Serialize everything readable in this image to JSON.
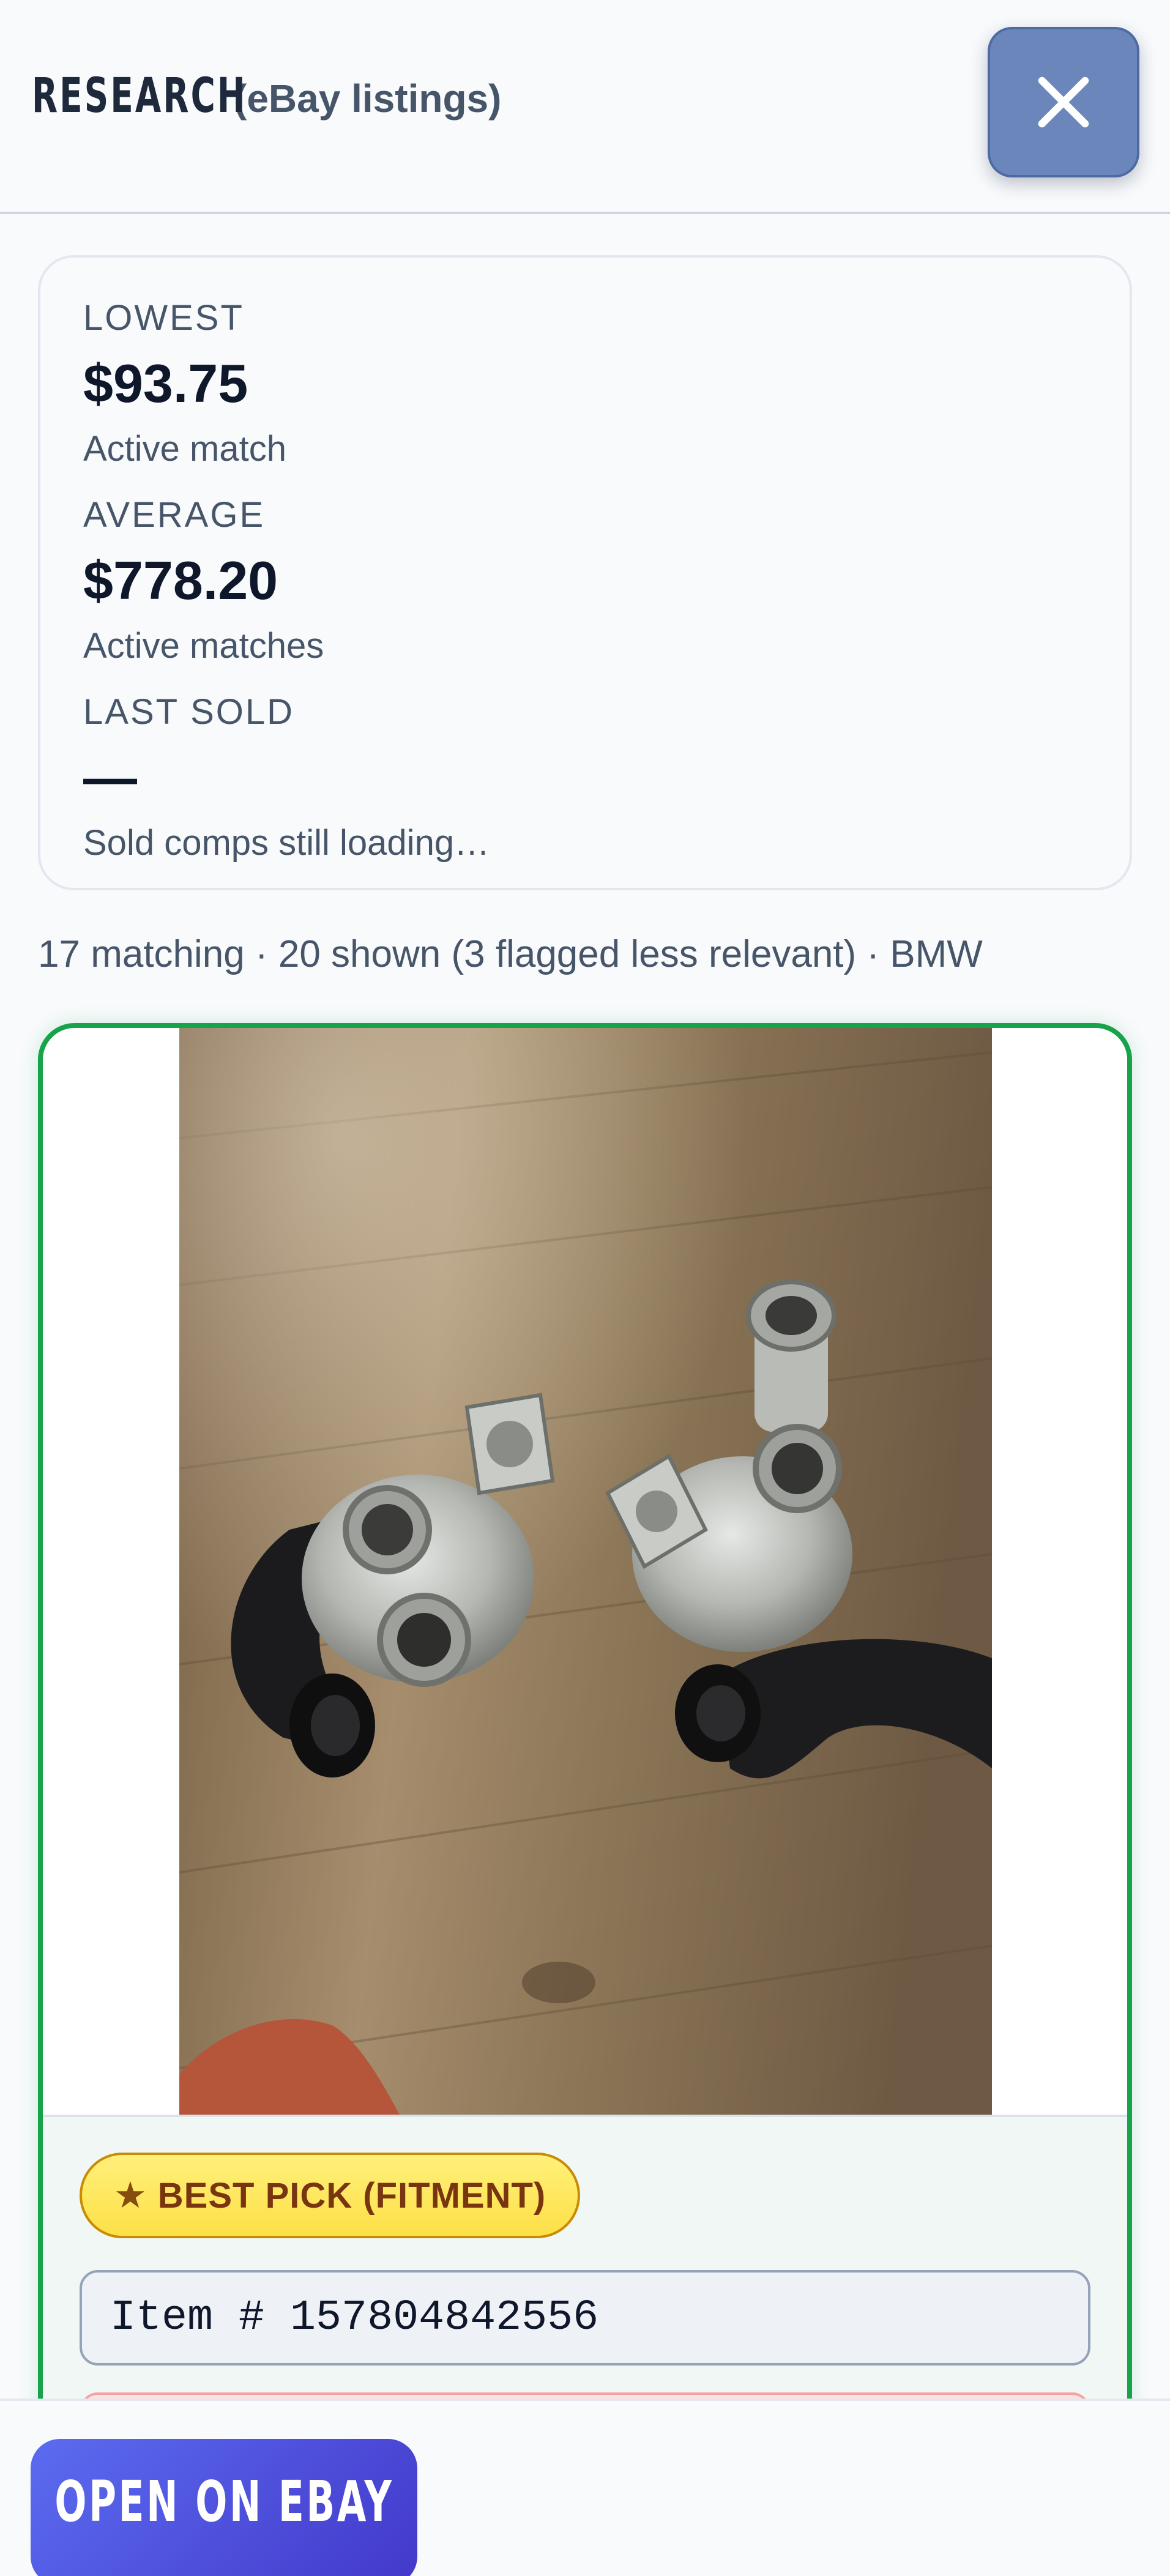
{
  "header": {
    "title": "RESEARCH",
    "subtitle": "(eBay listings)",
    "close_icon": "close-icon"
  },
  "stats": {
    "lowest": {
      "label": "LOWEST",
      "value": "$93.75",
      "note": "Active match"
    },
    "average": {
      "label": "AVERAGE",
      "value": "$778.20",
      "note": "Active matches"
    },
    "last_sold": {
      "label": "LAST SOLD",
      "value": "—",
      "note": "Sold comps still loading…"
    }
  },
  "summary": "17 matching · 20 shown (3 flagged less relevant) · BMW",
  "listing": {
    "badge_icon": "star-icon",
    "badge_star": "★",
    "badge": "BEST PICK (FITMENT)",
    "item_number": "Item # 157804842556"
  },
  "footer": {
    "open_button": "OPEN ON EBAY"
  },
  "colors": {
    "best_pick_border": "#16a34a",
    "badge_fill": "#fde047",
    "close_button": "#6b86bb",
    "open_button": "#4f46e5"
  }
}
